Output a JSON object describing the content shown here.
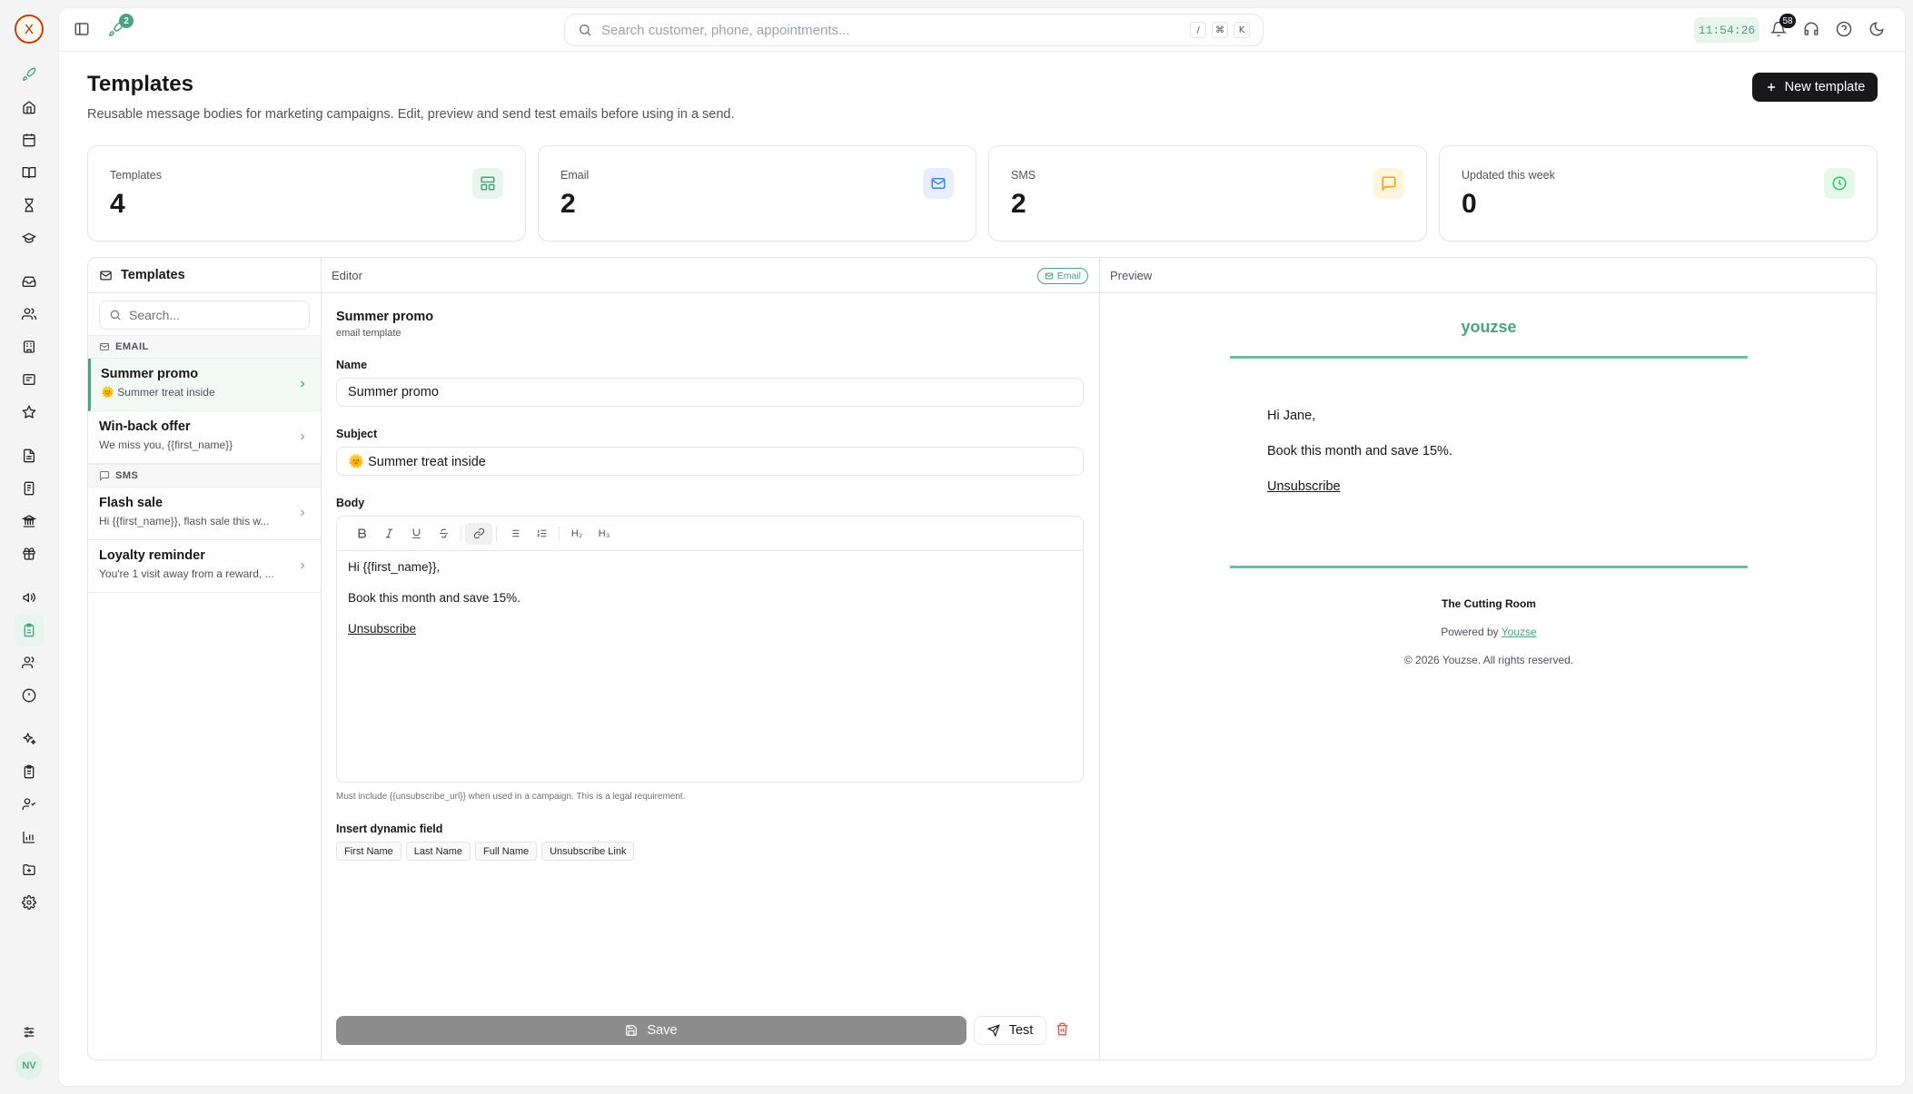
{
  "app": {
    "logo_letter": "X",
    "user_initials": "NV"
  },
  "topbar": {
    "rocket_badge": "2",
    "search_placeholder": "Search customer, phone, appointments...",
    "shortcut_keys": [
      "/",
      "⌘",
      "K"
    ],
    "time": "11:54:26",
    "notification_count": "58"
  },
  "header": {
    "title": "Templates",
    "subtitle": "Reusable message bodies for marketing campaigns. Edit, preview and send test emails before using in a send.",
    "new_button": "New template"
  },
  "stats": [
    {
      "label": "Templates",
      "value": "4",
      "icon": "layout-icon",
      "color": "#4aa37f",
      "bg": "#e8f5ef"
    },
    {
      "label": "Email",
      "value": "2",
      "icon": "mail-icon",
      "color": "#3b82f6",
      "bg": "#e7efff"
    },
    {
      "label": "SMS",
      "value": "2",
      "icon": "message-icon",
      "color": "#f59e0b",
      "bg": "#fff4dc"
    },
    {
      "label": "Updated this week",
      "value": "0",
      "icon": "clock-icon",
      "color": "#22c55e",
      "bg": "#e6f8ec"
    }
  ],
  "list": {
    "title": "Templates",
    "search_placeholder": "Search...",
    "groups": [
      {
        "label": "EMAIL",
        "items": [
          {
            "title": "Summer promo",
            "subtitle": "🌞 Summer treat inside"
          },
          {
            "title": "Win-back offer",
            "subtitle": "We miss you, {{first_name}}"
          }
        ]
      },
      {
        "label": "SMS",
        "items": [
          {
            "title": "Flash sale",
            "subtitle": "Hi {{first_name}}, flash sale this w..."
          },
          {
            "title": "Loyalty reminder",
            "subtitle": "You're 1 visit away from a reward, ..."
          }
        ]
      }
    ]
  },
  "editor": {
    "header": "Editor",
    "badge": "Email",
    "template_title": "Summer promo",
    "template_type": "email template",
    "name_label": "Name",
    "name_value": "Summer promo",
    "subject_label": "Subject",
    "subject_value": "🌞 Summer treat inside",
    "body_label": "Body",
    "toolbar": {
      "h2": "H₂",
      "h3": "H₃"
    },
    "body": {
      "greeting": "Hi {{first_name}},",
      "line": "Book this month and save 15%.",
      "unsubscribe": "Unsubscribe"
    },
    "hint": "Must include {{unsubscribe_url}} when used in a campaign. This is a legal requirement.",
    "dynamic_label": "Insert dynamic field",
    "dynamic_fields": [
      "First Name",
      "Last Name",
      "Full Name",
      "Unsubscribe Link"
    ],
    "save_label": "Save",
    "test_label": "Test"
  },
  "preview": {
    "header": "Preview",
    "brand": "youzse",
    "greeting": "Hi Jane,",
    "line": "Book this month and save 15%.",
    "unsubscribe": "Unsubscribe",
    "business": "The Cutting Room",
    "powered_prefix": "Powered by",
    "powered_link": "Youzse",
    "copyright": "© 2026 Youzse. All rights reserved."
  }
}
